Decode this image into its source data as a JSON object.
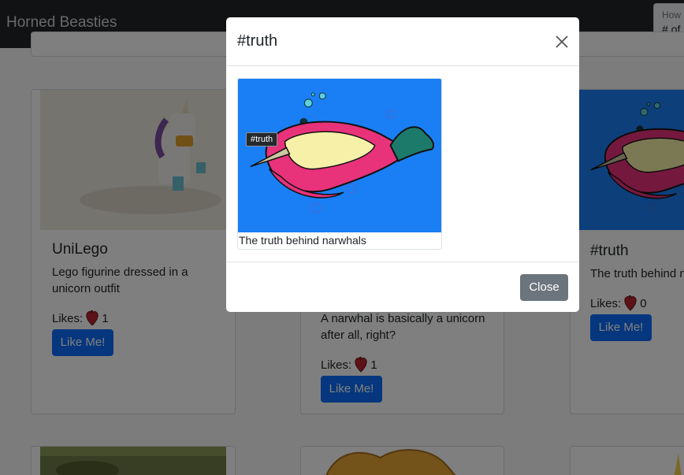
{
  "navbar": {
    "brand": "Horned Beasties",
    "filter_label": "How",
    "filter_value": "# of"
  },
  "cards": [
    {
      "title": "UniLego",
      "description_line1": "Lego figurine dressed in a",
      "description_line2": "unicorn outfit",
      "likes_label": "Likes:",
      "likes_count": "1",
      "button_label": "Like Me!"
    },
    {
      "title": "",
      "description_line1": "A narwhal is basically a unicorn",
      "description_line2": "after all, right?",
      "likes_label": "Likes:",
      "likes_count": "1",
      "button_label": "Like Me!"
    },
    {
      "title": "#truth",
      "description_line1": "The truth behind n",
      "likes_label": "Likes:",
      "likes_count": "0",
      "button_label": "Like Me!"
    }
  ],
  "modal": {
    "title": "#truth",
    "tooltip": "#truth",
    "caption": "The truth behind narwhals",
    "close_label": "Close"
  },
  "icons": {
    "close": "close-x-icon",
    "heart": "anatomical-heart-icon"
  },
  "colors": {
    "primary": "#0d6efd",
    "secondary": "#6c757d",
    "navbar": "#212529",
    "narwhal_bg": "#1a7ff5"
  }
}
